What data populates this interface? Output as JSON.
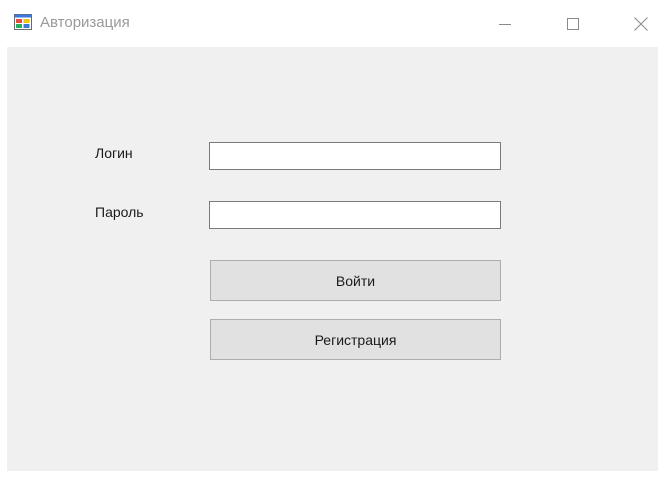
{
  "window": {
    "title": "Авторизация",
    "icon": "winforms-app-icon"
  },
  "titlebar_controls": {
    "minimize": "minimize-icon",
    "maximize": "maximize-icon",
    "close": "close-icon"
  },
  "form": {
    "login_label": "Логин",
    "login_value": "",
    "password_label": "Пароль",
    "password_value": "",
    "login_button": "Войти",
    "register_button": "Регистрация"
  },
  "colors": {
    "client_background": "#f0f0f0",
    "button_face": "#e1e1e1",
    "button_border": "#adadad",
    "title_text": "#9a9a9a"
  }
}
